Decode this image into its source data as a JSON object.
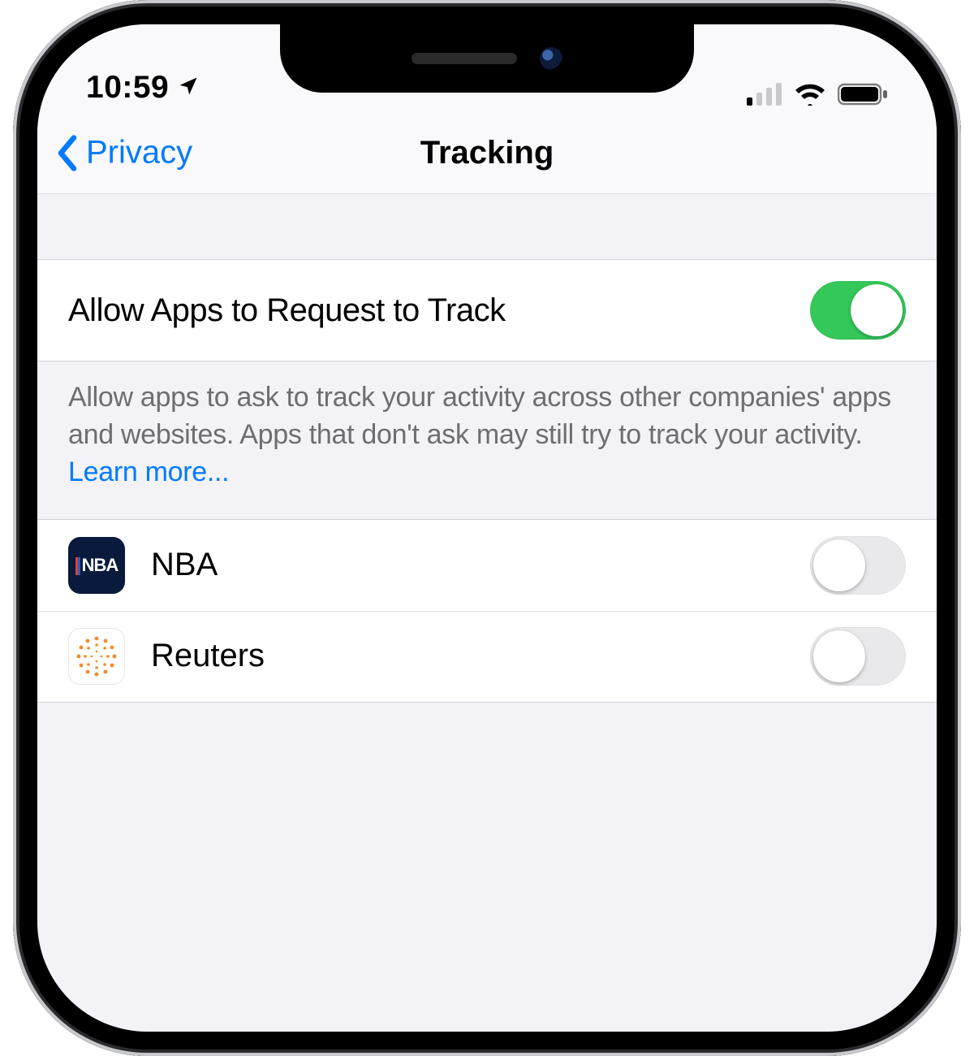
{
  "status": {
    "time": "10:59",
    "location_icon": "location-arrow-icon",
    "signal_bars": 1,
    "wifi_bars": 3,
    "battery_full": true
  },
  "nav": {
    "back_label": "Privacy",
    "title": "Tracking"
  },
  "main_setting": {
    "label": "Allow Apps to Request to Track",
    "on": true
  },
  "footer": {
    "text": "Allow apps to ask to track your activity across other companies' apps and websites. Apps that don't ask may still try to track your activity. ",
    "link": "Learn more..."
  },
  "apps": [
    {
      "name": "NBA",
      "icon": "nba",
      "on": false
    },
    {
      "name": "Reuters",
      "icon": "reuters",
      "on": false
    }
  ],
  "colors": {
    "tint": "#007aff",
    "switch_on": "#34c759",
    "bg": "#f2f2f7"
  }
}
